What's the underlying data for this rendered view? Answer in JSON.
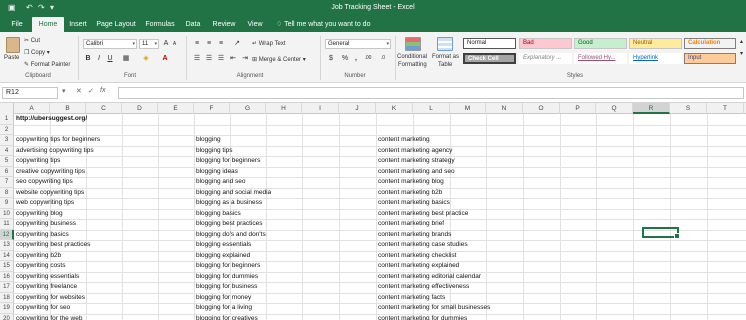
{
  "window": {
    "title": "Job Tracking Sheet - Excel"
  },
  "quick_access": [
    {
      "name": "save-icon",
      "glyph": "▣"
    },
    {
      "name": "undo-icon",
      "glyph": "↶"
    },
    {
      "name": "redo-icon",
      "glyph": "↷"
    },
    {
      "name": "customize-icon",
      "glyph": "▾"
    }
  ],
  "tabs": [
    "File",
    "Home",
    "Insert",
    "Page Layout",
    "Formulas",
    "Data",
    "Review",
    "View"
  ],
  "active_tab": "Home",
  "tell_me": "Tell me what you want to do",
  "ribbon": {
    "clipboard": {
      "paste": "Paste",
      "cut": "Cut",
      "copy": "Copy",
      "format_painter": "Format Painter",
      "label": "Clipboard"
    },
    "font": {
      "family": "Calibri",
      "size": "11",
      "grow": "A",
      "shrink": "A",
      "bold": "B",
      "italic": "I",
      "underline": "U",
      "label": "Font"
    },
    "alignment": {
      "wrap_text": "Wrap Text",
      "merge_center": "Merge & Center",
      "label": "Alignment"
    },
    "number": {
      "format": "General",
      "currency": "$",
      "percent": "%",
      "comma": ",",
      "inc_decimal": ".00",
      "dec_decimal": ".0",
      "label": "Number"
    },
    "styles": {
      "conditional_1": "Conditional",
      "conditional_2": "Formatting",
      "format_table_1": "Format as",
      "format_table_2": "Table",
      "normal": "Normal",
      "bad": "Bad",
      "good": "Good",
      "neutral": "Neutral",
      "calculation": "Calculation",
      "check_cell": "Check Cell",
      "explanatory": "Explanatory ...",
      "followed_hy": "Followed Hy...",
      "hyperlink": "Hyperlink",
      "input": "Input",
      "label": "Styles"
    }
  },
  "formula_bar": {
    "name_box": "R12",
    "fx": "fx",
    "value": ""
  },
  "columns": [
    "A",
    "B",
    "C",
    "D",
    "E",
    "F",
    "G",
    "H",
    "I",
    "J",
    "K",
    "L",
    "M",
    "N",
    "O",
    "P",
    "Q",
    "R",
    "S",
    "T"
  ],
  "selected_column": "R",
  "selected_row": "12",
  "rows": [
    "1",
    "2",
    "3",
    "4",
    "5",
    "6",
    "7",
    "8",
    "9",
    "10",
    "11",
    "12",
    "13",
    "14",
    "15",
    "16",
    "17",
    "18",
    "19",
    "20"
  ],
  "cells": {
    "a1": "http://ubersuggest.org/",
    "col_a": [
      "",
      "",
      "copywriting tips for beginners",
      "advertising copywriting tips",
      "copywriting tips",
      "creative copywriting tips",
      "seo copywriting tips",
      "website copywriting tips",
      "web copywriting tips",
      "copywriting blog",
      "copywriting business",
      "copywriting basics",
      "copywriting best practices",
      "copywriting b2b",
      "copywriting costs",
      "copywriting essentials",
      "copywriting freelance",
      "copywriting for websites",
      "copywriting for seo",
      "copywriting for the web"
    ],
    "col_f": [
      "",
      "",
      "blogging",
      "blogging tips",
      "blogging for beginners",
      "blogging ideas",
      "blogging and seo",
      "blogging and social media",
      "blogging as a business",
      "blogging basics",
      "blogging best practices",
      "blogging do's and don'ts",
      "blogging essentials",
      "blogging explained",
      "blogging for beginners",
      "blogging for dummies",
      "blogging for business",
      "blogging for money",
      "blogging for a living",
      "blogging for creatives"
    ],
    "col_k": [
      "",
      "",
      "content marketing",
      "content marketing agency",
      "content marketing strategy",
      "content marketing and seo",
      "content marketing blog",
      "content marketing b2b",
      "content marketing basics",
      "content marketing best practice",
      "content marketing brief",
      "content marketing brands",
      "content marketing case studies",
      "content marketing checklist",
      "content marketing explained",
      "content marketing editorial calendar",
      "content marketing effectiveness",
      "content marketing facts",
      "content marketing for small businesses",
      "content marketing for dummies"
    ]
  },
  "colors": {
    "brand": "#217346",
    "bad_bg": "#ffc7ce",
    "bad_fg": "#9c0006",
    "good_bg": "#c6efce",
    "good_fg": "#006100",
    "neutral_bg": "#ffeb9c",
    "neutral_fg": "#9c5700",
    "calc_bg": "#f2f2f2",
    "calc_fg": "#fa7d00",
    "check_bg": "#a5a5a5",
    "input_bg": "#ffcc99",
    "input_fg": "#3f3f76",
    "link": "#0563c1",
    "followed": "#954f72"
  }
}
